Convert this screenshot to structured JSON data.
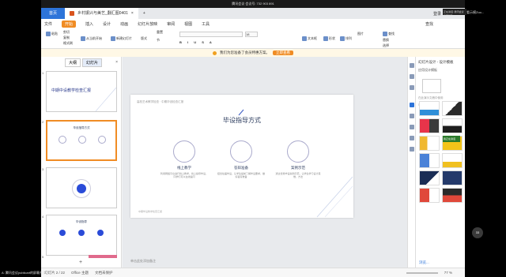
{
  "meeting": {
    "title": "腾讯会议 会议号: 732 903 891"
  },
  "window": {
    "tab_home": "首页",
    "tab_doc": "乡村振兴与美艺_翻汇图0401",
    "sign_in": "登录"
  },
  "menu": {
    "file": "文件",
    "start": "开始",
    "insert": "插入",
    "design": "设计",
    "animation": "动画",
    "slideshow": "幻灯片放映",
    "review": "审阅",
    "view": "视图",
    "tools": "工具",
    "search": "查找"
  },
  "ribbon": {
    "paste": "粘贴",
    "cut": "剪切",
    "copy": "复制",
    "format_painter": "格式刷",
    "from_current": "从当前开始",
    "new_slide": "新建幻灯片",
    "layout": "版式",
    "section": "节",
    "reset": "重置",
    "textbox": "文本框",
    "shape": "形状",
    "arrange": "排列",
    "picture": "图片",
    "find": "查找",
    "replace": "替换",
    "select": "选择",
    "font_size": "18"
  },
  "notify": {
    "text": "我们为您准备了会员特惠方案。",
    "button": "立即查看"
  },
  "left_panel": {
    "tab_outline": "大纲",
    "tab_slides": "幻灯片",
    "close": "×",
    "thumb1_title": "中期中设教学检查汇报",
    "thumb2_title": "毕设指导方式",
    "thumb4_title": "毕设指导",
    "numbers": [
      "1",
      "2",
      "3",
      "4",
      "5"
    ]
  },
  "slide": {
    "header": "高校艺术教学检查 · 中期毕设检查汇报",
    "title": "毕设指导方式",
    "items": [
      {
        "label": "线上教学",
        "desc": "利用网络平台进行线上教学，线上指导毕设，同学们可以在线提问"
      },
      {
        "label": "答辩准备",
        "desc": "结合往届毕设，让学生提前了解毕设要求，做好答辩准备"
      },
      {
        "label": "案例示范",
        "desc": "通过优秀毕设案例示范，让学生学习设计思维、方法"
      }
    ],
    "footer": "中期毕设教学检查汇报"
  },
  "notes": {
    "placeholder": "单击此处添加备注"
  },
  "right_panel": {
    "title": "幻灯片设计 - 设计模板",
    "current_label": "应用设计模板",
    "hint": "在此演示文稿中使用",
    "recent": "可供使用",
    "browse": "浏览..."
  },
  "status": {
    "slide_info": "幻灯片 2 / 22",
    "theme": "Office 主题",
    "doc_protect": "文档未保护",
    "zoom": "77 %"
  },
  "side": {
    "user_tag": "正在讲话: 腾讯会议publicart",
    "viewer_tag": "看示模Zoo...",
    "speaker": "我正在讲话",
    "bottom_tag": "A: 腾讯会议publicart的屏幕共享",
    "mic_badge": "33"
  }
}
